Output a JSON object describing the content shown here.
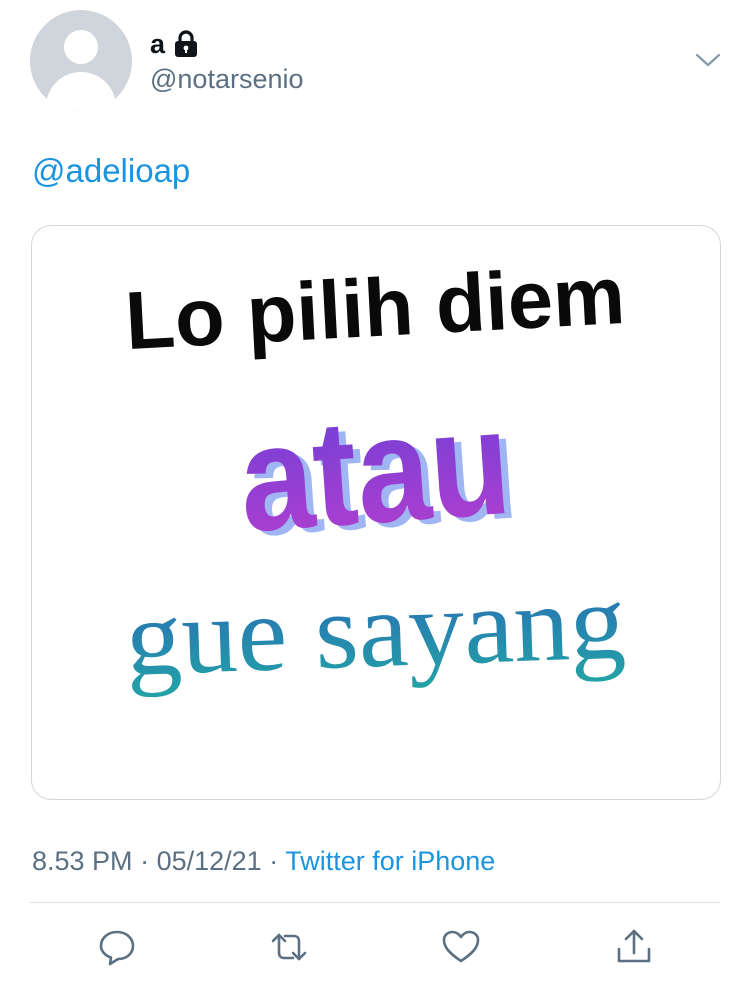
{
  "tweet": {
    "author": {
      "display_name": "a",
      "handle": "@notarsenio",
      "avatar_icon": "default-avatar-icon",
      "protected_icon": "lock-icon"
    },
    "menu_icon": "chevron-down-icon",
    "text": "@adelioap",
    "media": {
      "line1": "Lo pilih diem",
      "line2": "atau",
      "line3": "gue sayang"
    },
    "time": "8.53 PM",
    "date": "05/12/21",
    "separator": "·",
    "source": "Twitter for iPhone",
    "actions": [
      {
        "icon": "reply-icon"
      },
      {
        "icon": "retweet-icon"
      },
      {
        "icon": "like-icon"
      },
      {
        "icon": "share-icon"
      }
    ]
  },
  "colors": {
    "link": "#1b95e0",
    "secondary_text": "#5b7083",
    "primary_text": "#0f1419"
  }
}
